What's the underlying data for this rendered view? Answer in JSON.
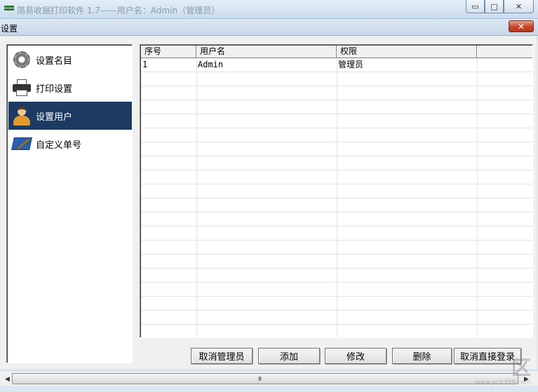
{
  "window": {
    "title": "简易收据打印软件 1.7——用户名：Admin（管理员）",
    "min_glyph": "▭",
    "max_glyph": "□",
    "close_glyph": "✕"
  },
  "dialog": {
    "title": "设置",
    "close_glyph": "✕"
  },
  "sidebar": {
    "items": [
      {
        "label": "设置名目",
        "icon": "gear-icon",
        "active": false
      },
      {
        "label": "打印设置",
        "icon": "printer-icon",
        "active": false
      },
      {
        "label": "设置用户",
        "icon": "user-icon",
        "active": true
      },
      {
        "label": "自定义单号",
        "icon": "pen-pad-icon",
        "active": false
      }
    ]
  },
  "table": {
    "columns": [
      "序号",
      "用户名",
      "权限"
    ],
    "rows": [
      [
        "1",
        "Admin",
        "管理员"
      ]
    ]
  },
  "buttons": {
    "cancel_admin": "取消管理员",
    "add": "添加",
    "edit": "修改",
    "delete": "删除",
    "cancel_direct_login": "取消直接登录"
  },
  "scrollbar": {
    "left_arrow": "◀",
    "right_arrow": "▶",
    "grip": "III"
  },
  "watermark": {
    "big": "区",
    "small": "www.pc6359.com"
  },
  "colors": {
    "active_item_bg": "#1c3a63",
    "close_red": "#c7442a"
  }
}
